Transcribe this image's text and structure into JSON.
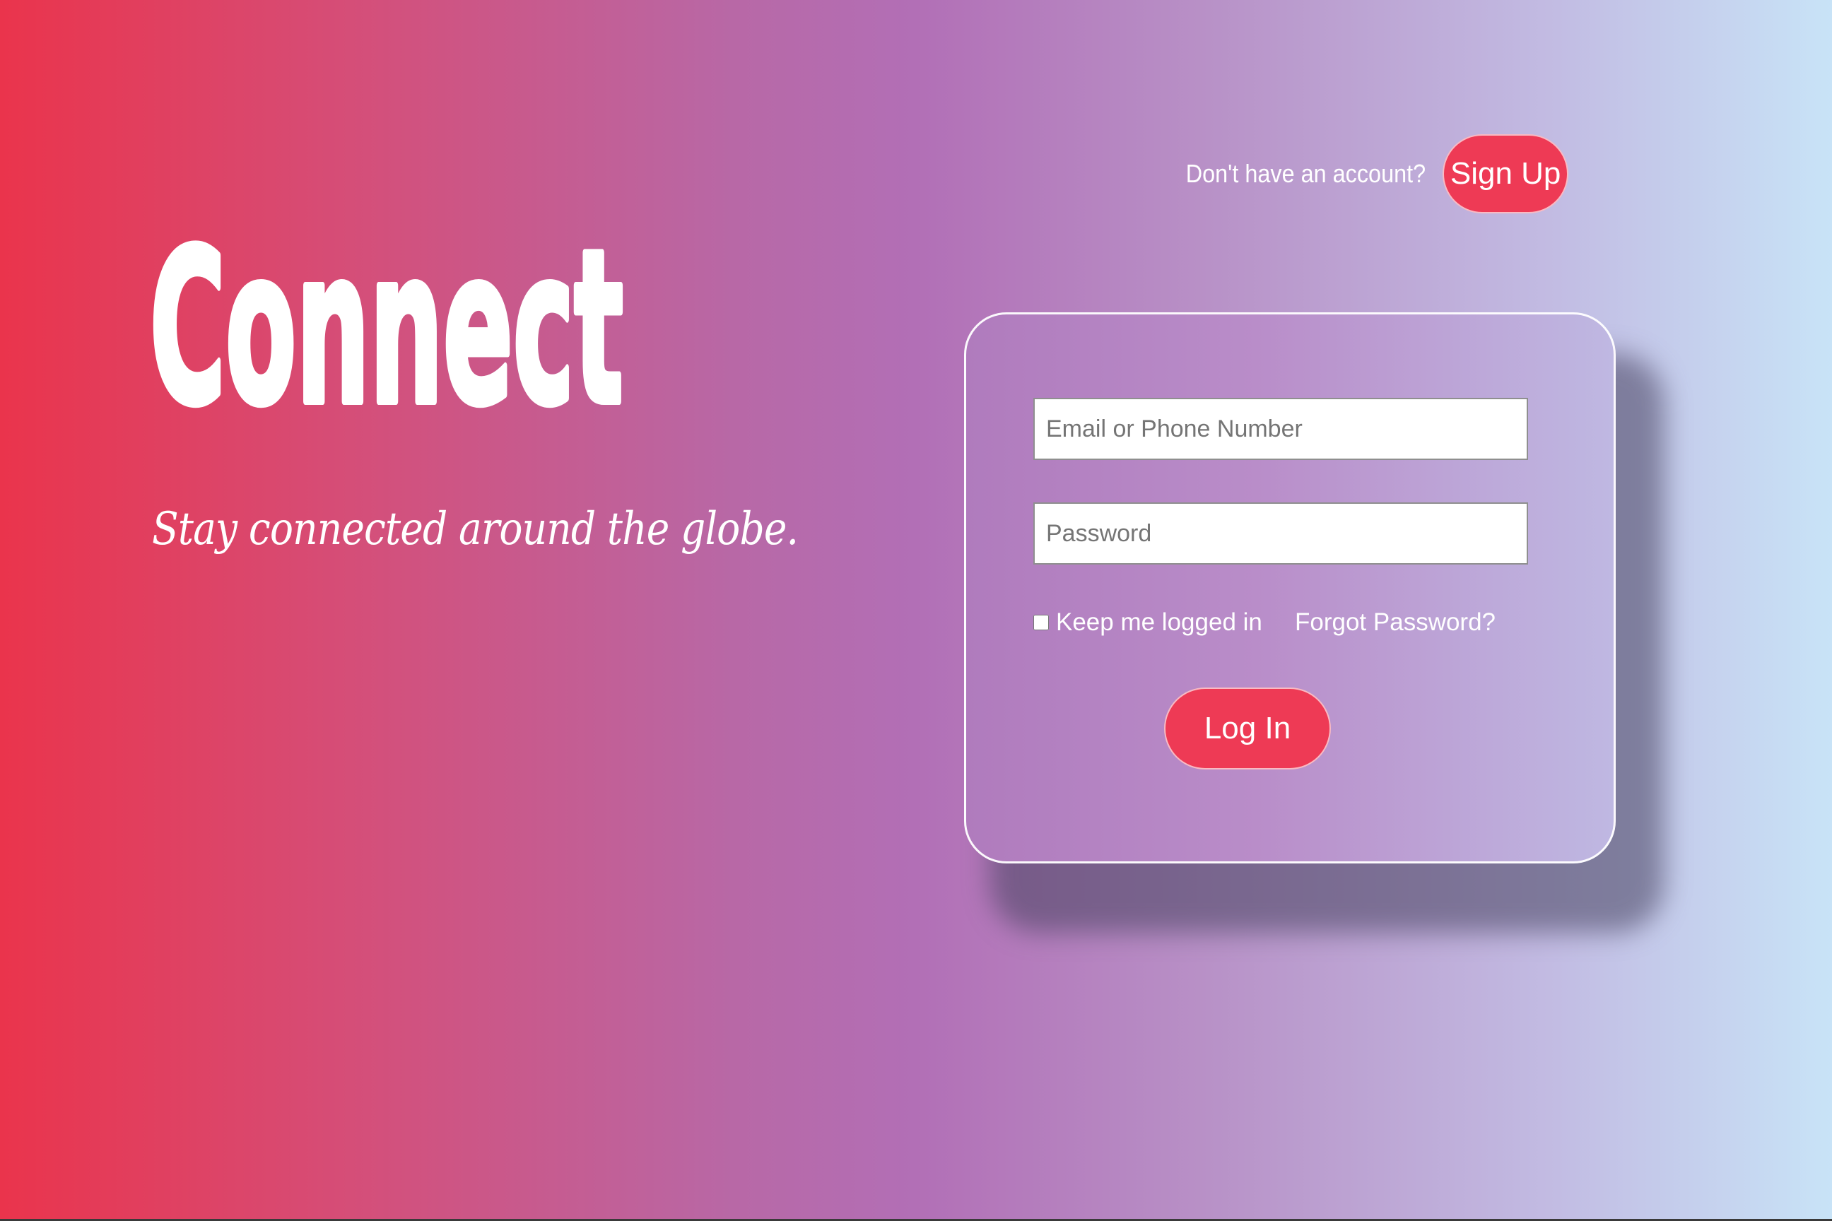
{
  "brand": {
    "logo_text": "Connect",
    "tagline": "Stay connected around the globe."
  },
  "header": {
    "signup_prompt": "Don't have an account?",
    "signup_label": "Sign Up"
  },
  "login_form": {
    "email_placeholder": "Email or Phone Number",
    "email_value": "",
    "password_placeholder": "Password",
    "password_value": "",
    "remember_label": "Keep me logged in",
    "remember_checked": false,
    "forgot_label": "Forgot Password?",
    "login_label": "Log In"
  },
  "colors": {
    "accent": "#ee3a55",
    "gradient_start": "#ea344c",
    "gradient_mid": "#b26fb6",
    "gradient_end": "#c8e3f7"
  }
}
